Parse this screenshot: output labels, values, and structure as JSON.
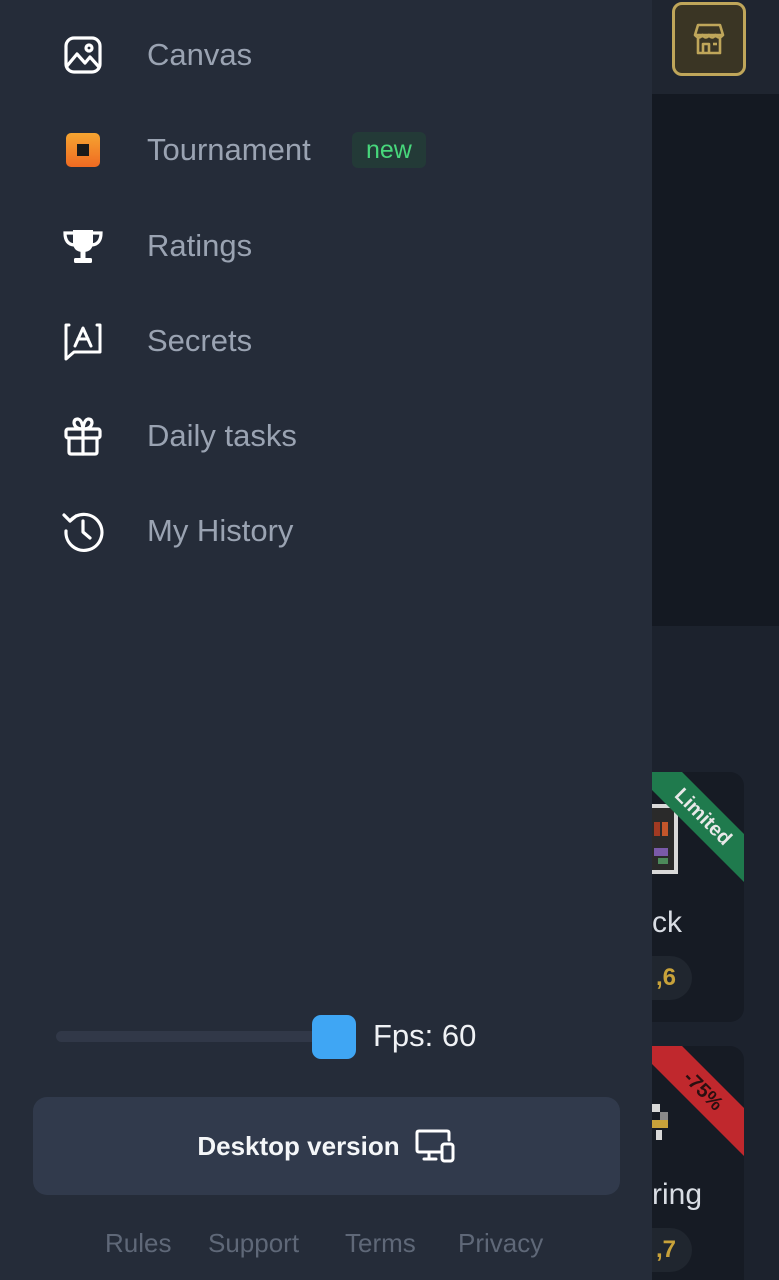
{
  "menu": {
    "items": [
      {
        "label": "Canvas",
        "icon": "image-icon"
      },
      {
        "label": "Tournament",
        "icon": "tournament-icon",
        "badge": "new"
      },
      {
        "label": "Ratings",
        "icon": "trophy-icon"
      },
      {
        "label": "Secrets",
        "icon": "chat-letter-icon"
      },
      {
        "label": "Daily tasks",
        "icon": "gift-icon"
      },
      {
        "label": "My History",
        "icon": "history-icon"
      }
    ]
  },
  "fps": {
    "label": "Fps: 60",
    "value": 60
  },
  "desktop": {
    "label": "Desktop version",
    "icon": "devices-icon"
  },
  "footer": {
    "links": [
      "Rules",
      "Support",
      "Terms",
      "Privacy"
    ]
  },
  "background": {
    "shop_icon": "shop-icon",
    "cards": [
      {
        "ribbon": "Limited",
        "name_fragment": "ck",
        "price_fragment": ",6"
      },
      {
        "ribbon": "-75%",
        "name_fragment": "ring",
        "price_fragment": ",7"
      }
    ]
  },
  "colors": {
    "drawer_bg": "#252c39",
    "accent_blue": "#3fa6f4",
    "badge_green": "#47d77b",
    "shop_gold": "#bfa65a",
    "ribbon_green": "#1f7a4d",
    "ribbon_red": "#c0282d",
    "price_gold": "#c8a23a"
  }
}
